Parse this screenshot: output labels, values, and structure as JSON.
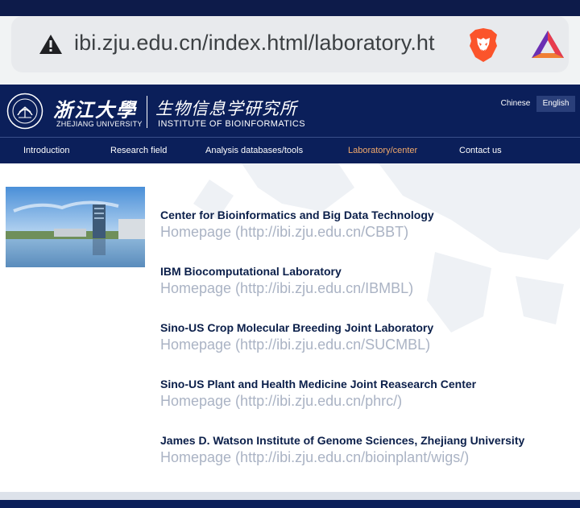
{
  "browser": {
    "url": "ibi.zju.edu.cn/index.html/laboratory.ht",
    "icons": [
      "warning-icon",
      "brave-lion-icon",
      "brave-rewards-icon"
    ]
  },
  "header": {
    "university_cn": "浙江大學",
    "university_en": "ZHEJIANG UNIVERSITY",
    "institute_cn": "生物信息学研究所",
    "institute_en": "INSTITUTE OF BIOINFORMATICS",
    "lang": {
      "chinese": "Chinese",
      "english": "English"
    }
  },
  "nav": {
    "items": [
      {
        "label": "Introduction"
      },
      {
        "label": "Research field"
      },
      {
        "label": "Analysis databases/tools"
      },
      {
        "label": "Laboratory/center",
        "active": true
      },
      {
        "label": "Contact us"
      }
    ]
  },
  "labs": [
    {
      "name": "Center for Bioinformatics and Big Data Technology",
      "link": "Homepage (http://ibi.zju.edu.cn/CBBT)"
    },
    {
      "name": "IBM Biocomputational Laboratory",
      "link": "Homepage (http://ibi.zju.edu.cn/IBMBL)"
    },
    {
      "name": "Sino-US Crop Molecular Breeding Joint Laboratory",
      "link": "Homepage (http://ibi.zju.edu.cn/SUCMBL)"
    },
    {
      "name": "Sino-US Plant and Health Medicine Joint Reasearch Center",
      "link": "Homepage (http://ibi.zju.edu.cn/phrc/)"
    },
    {
      "name": "James D. Watson Institute of Genome Sciences, Zhejiang University",
      "link": "Homepage (http://ibi.zju.edu.cn/bioinplant/wigs/)"
    }
  ],
  "colors": {
    "header_bg": "#0b1f5a",
    "nav_active": "#f0a86a",
    "lab_name": "#0b1f4a",
    "lab_link": "#aab3c4"
  }
}
